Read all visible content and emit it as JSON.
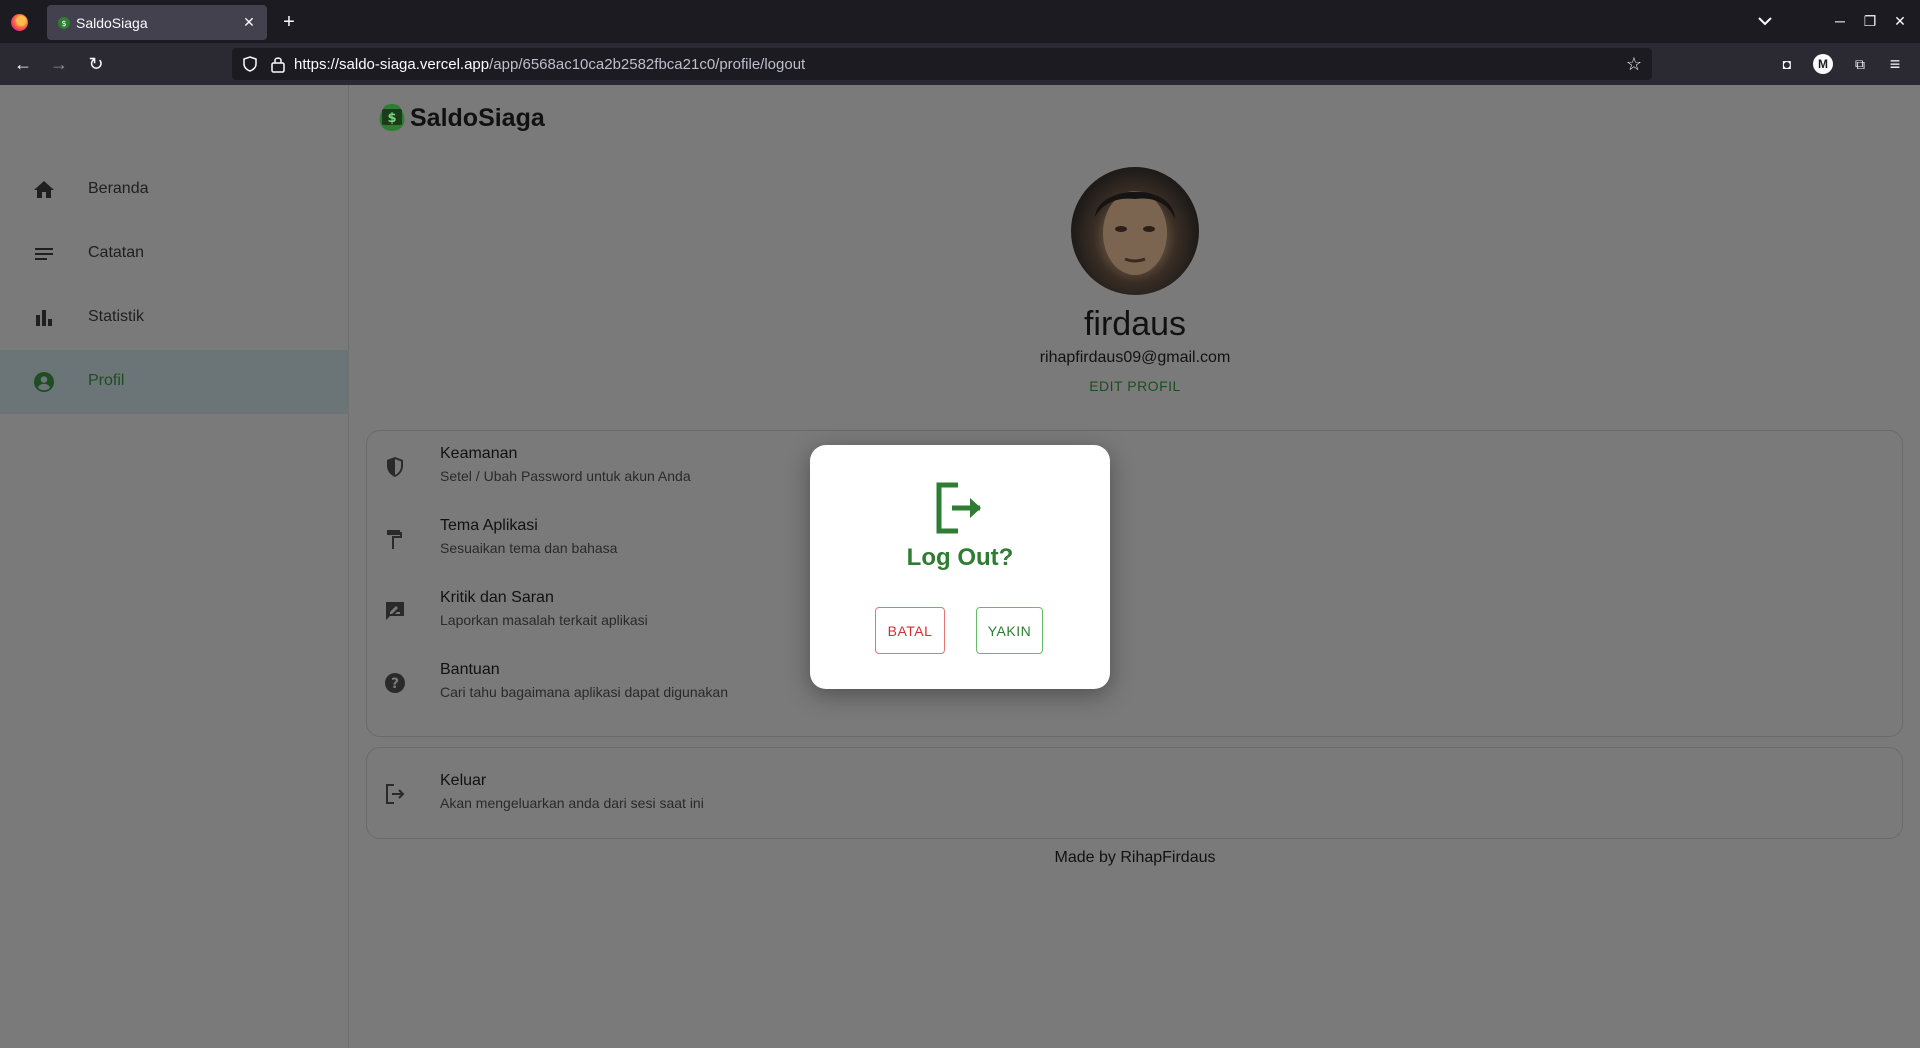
{
  "browser": {
    "tab_title": "SaldoSiaga",
    "url_host": "https://saldo-siaga.vercel.app",
    "url_path": "/app/6568ac10ca2b2582fbca21c0/profile/logout",
    "account_initial": "M"
  },
  "app": {
    "brand": "SaldoSiaga",
    "accent_color": "#2e7d32",
    "sidebar": {
      "items": [
        {
          "label": "Beranda",
          "icon": "home-icon",
          "active": false
        },
        {
          "label": "Catatan",
          "icon": "notes-icon",
          "active": false
        },
        {
          "label": "Statistik",
          "icon": "bar-chart-icon",
          "active": false
        },
        {
          "label": "Profil",
          "icon": "account-circle-icon",
          "active": true
        }
      ]
    },
    "profile": {
      "name": "firdaus",
      "email": "rihapfirdaus09@gmail.com",
      "edit_label": "EDIT PROFIL"
    },
    "settings": [
      {
        "title": "Keamanan",
        "subtitle": "Setel / Ubah Password untuk akun Anda",
        "icon": "shield-icon"
      },
      {
        "title": "Tema Aplikasi",
        "subtitle": "Sesuaikan tema dan bahasa",
        "icon": "paint-roller-icon"
      },
      {
        "title": "Kritik dan Saran",
        "subtitle": "Laporkan masalah terkait aplikasi",
        "icon": "feedback-icon"
      },
      {
        "title": "Bantuan",
        "subtitle": "Cari tahu bagaimana aplikasi dapat digunakan",
        "icon": "help-icon"
      }
    ],
    "logout_row": {
      "title": "Keluar",
      "subtitle": "Akan mengeluarkan anda dari sesi saat ini",
      "icon": "logout-icon"
    },
    "footer": "Made by RihapFirdaus"
  },
  "modal": {
    "title": "Log Out?",
    "cancel_label": "BATAL",
    "confirm_label": "YAKIN",
    "icon": "logout-icon"
  }
}
